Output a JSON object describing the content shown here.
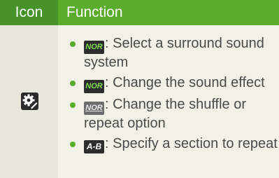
{
  "header": {
    "col_icon": "Icon",
    "col_function": "Function"
  },
  "row": {
    "icon": "settings-gear-icon",
    "items": [
      {
        "badge": "NOR",
        "text": ": Select a surround sound system"
      },
      {
        "badge": "NOR",
        "text": ": Change the sound effect"
      },
      {
        "badge": "NOR",
        "text": ": Change the shuffle or repeat option"
      },
      {
        "badge": "A-B",
        "text": ": Specify a section to repeat"
      }
    ]
  },
  "colors": {
    "header_green": "#5bab2c",
    "header_dark_green": "#47922a",
    "row_bg": "#f1f1e7",
    "bullet": "#5bab2c"
  }
}
